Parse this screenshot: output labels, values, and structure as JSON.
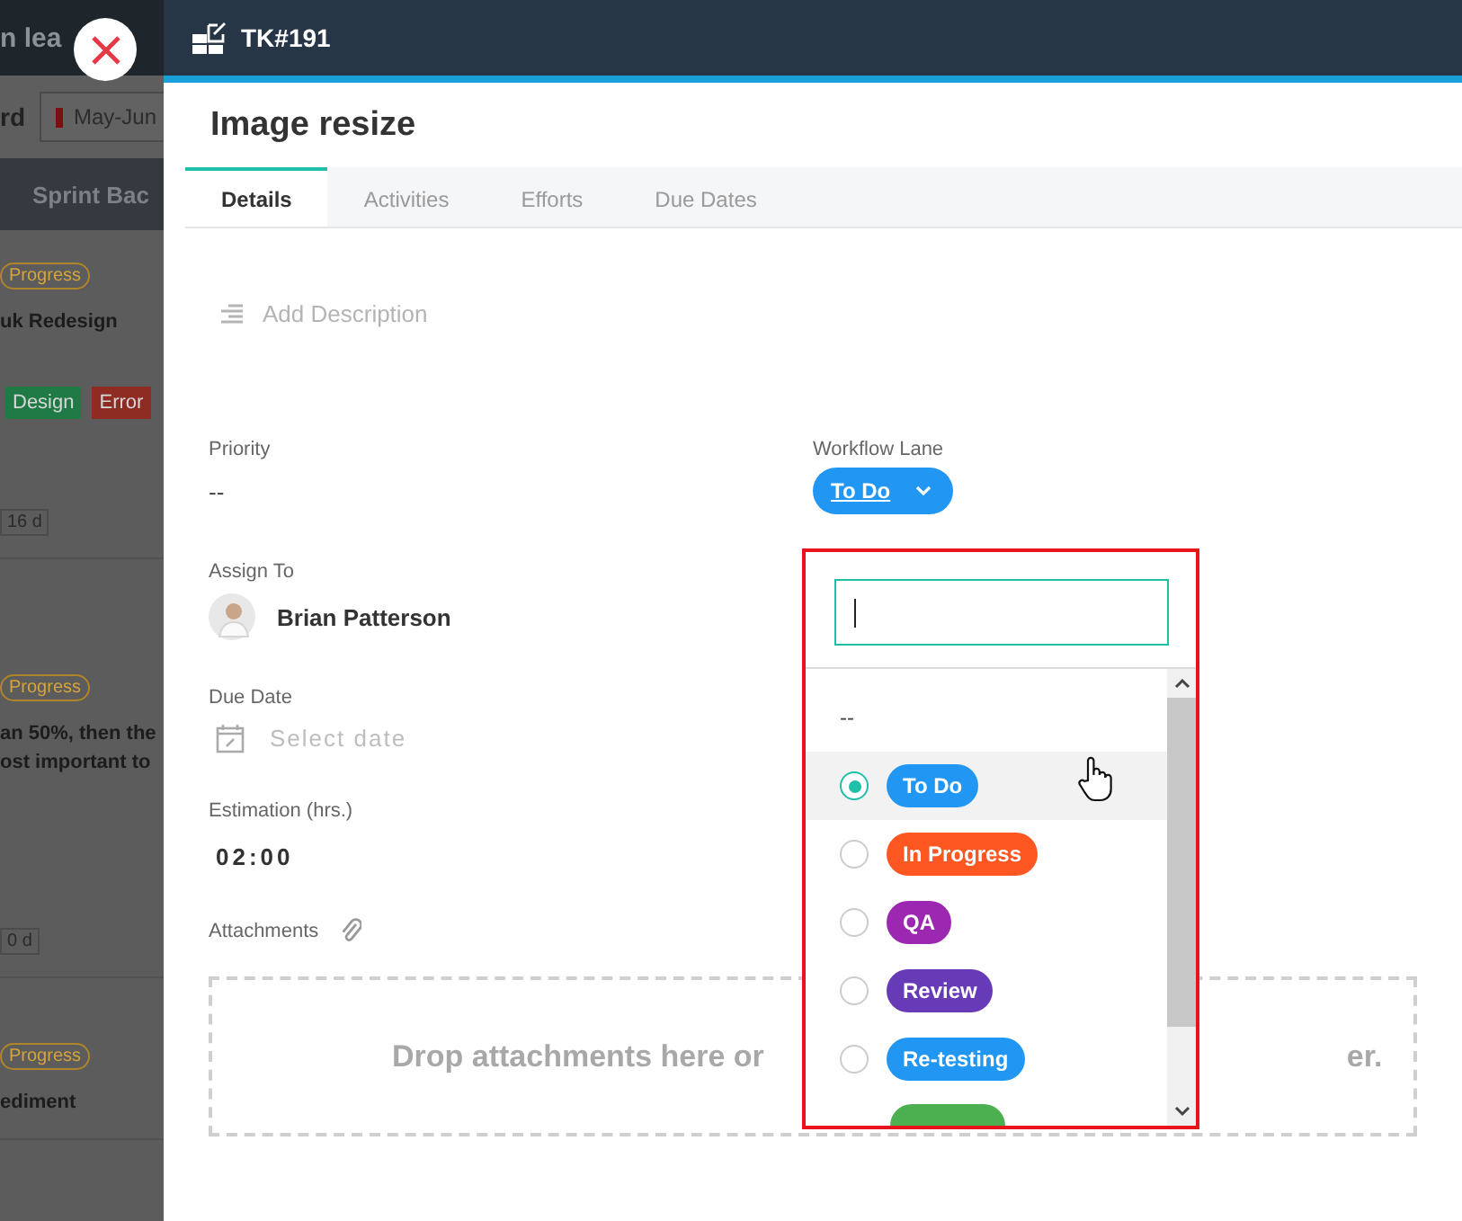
{
  "background_board": {
    "header_title": "n lea",
    "filter_label": "rd",
    "sprint_filter": "May-Jun",
    "section_title": "Sprint Bac",
    "cards": [
      {
        "status": "Progress",
        "lines": [
          "uk Redesign"
        ],
        "tags": [
          {
            "label": "Design",
            "color": "#1f7a45"
          },
          {
            "label": "Error",
            "color": "#8e2b22"
          }
        ],
        "duration": "16 d"
      },
      {
        "status": "Progress",
        "lines": [
          "an 50%, then the",
          "ost important to"
        ],
        "duration": "0 d"
      },
      {
        "status": "Progress",
        "lines": [
          "ediment"
        ]
      }
    ]
  },
  "task": {
    "id": "TK#191",
    "title": "Image resize",
    "tabs": [
      {
        "label": "Details",
        "selected": true
      },
      {
        "label": "Activities",
        "selected": false
      },
      {
        "label": "Efforts",
        "selected": false
      },
      {
        "label": "Due Dates",
        "selected": false
      }
    ],
    "description_placeholder": "Add Description",
    "priority": {
      "label": "Priority",
      "value": "--"
    },
    "workflow_lane": {
      "label": "Workflow Lane",
      "value": "To Do",
      "color": "#2196f3"
    },
    "assign_to": {
      "label": "Assign To",
      "value": "Brian Patterson"
    },
    "due_date": {
      "label": "Due Date",
      "placeholder": "Select date"
    },
    "estimation": {
      "label": "Estimation (hrs.)",
      "value": "02:00"
    },
    "attachments": {
      "label": "Attachments",
      "drop_text_left": "Drop attachments here or",
      "drop_text_right": "er."
    }
  },
  "lane_dropdown": {
    "search": {
      "focused": true
    },
    "options": [
      {
        "kind": "plain",
        "label": "--",
        "selected": false,
        "hovered": false
      },
      {
        "kind": "pill",
        "label": "To Do",
        "color": "#2196f3",
        "selected": true,
        "hovered": true
      },
      {
        "kind": "pill",
        "label": "In Progress",
        "color": "#ff5722",
        "selected": false,
        "hovered": false
      },
      {
        "kind": "pill",
        "label": "QA",
        "color": "#9c27b0",
        "selected": false,
        "hovered": false
      },
      {
        "kind": "pill",
        "label": "Review",
        "color": "#673ab7",
        "selected": false,
        "hovered": false
      },
      {
        "kind": "pill",
        "label": "Re-testing",
        "color": "#2196f3",
        "selected": false,
        "hovered": false
      },
      {
        "kind": "pill",
        "color": "#4caf50"
      }
    ]
  }
}
